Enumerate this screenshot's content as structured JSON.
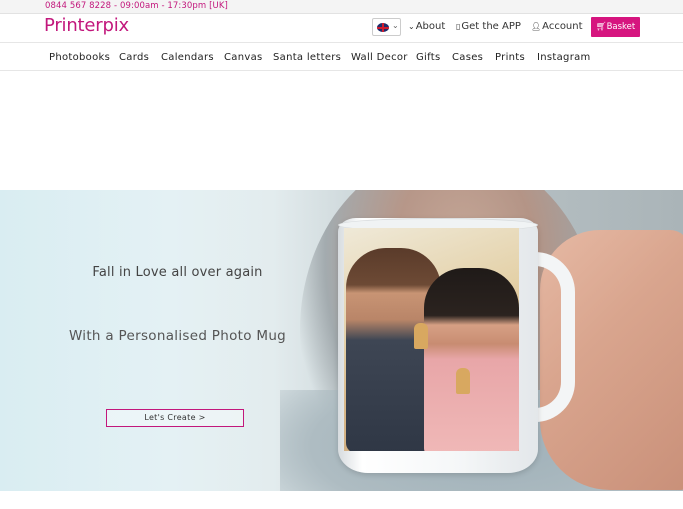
{
  "topbar": {
    "phone": "0844 567 8228 - 09:00am - 17:30pm [UK]"
  },
  "header": {
    "logo": "Printerpix",
    "language_selector": {
      "icon": "uk-flag-icon"
    },
    "links": {
      "about": "About",
      "get_app": "Get the APP",
      "account": "Account"
    },
    "basket_label": "Basket"
  },
  "nav": {
    "items": [
      "Photobooks",
      "Cards",
      "Calendars",
      "Canvas",
      "Santa letters",
      "Wall Decor",
      "Gifts",
      "Cases",
      "Prints",
      "Instagram"
    ]
  },
  "hero": {
    "title": "Fall in Love all over again",
    "subtitle": "With a Personalised Photo Mug",
    "cta_label": "Let's Create >"
  },
  "colors": {
    "brand": "#c2177c",
    "basket": "#d6157f"
  }
}
